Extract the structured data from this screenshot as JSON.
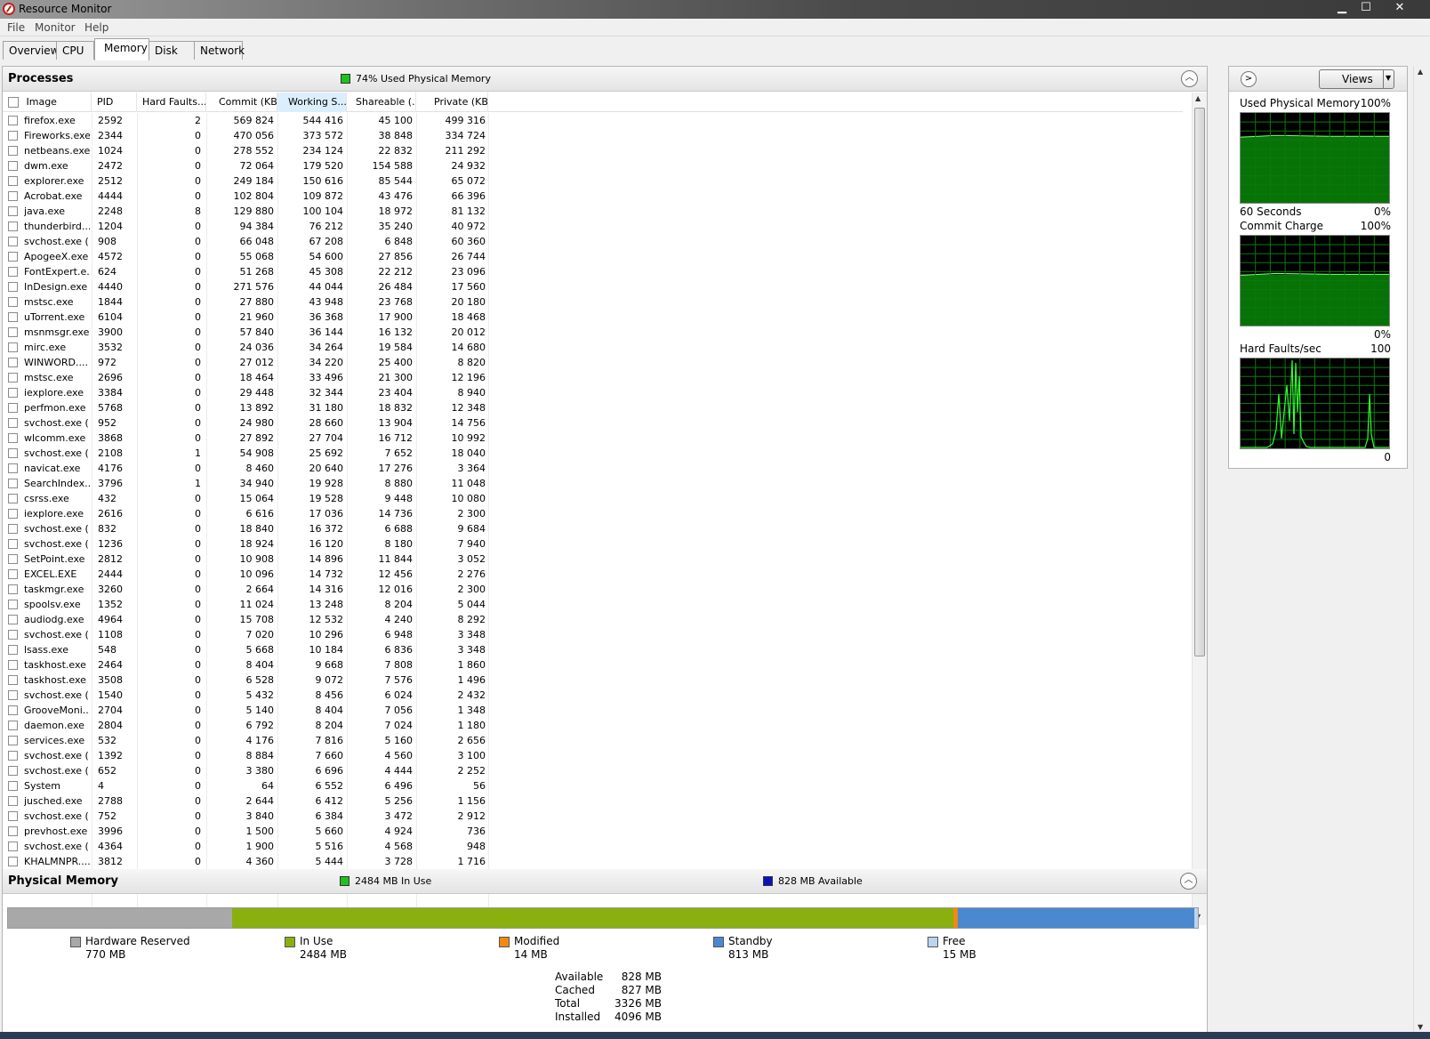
{
  "window": {
    "title": "Resource Monitor",
    "minimize": "▁",
    "maximize": "☐",
    "close": "✕"
  },
  "menu": [
    "File",
    "Monitor",
    "Help"
  ],
  "tabs": [
    "Overview",
    "CPU",
    "Memory",
    "Disk",
    "Network"
  ],
  "active_tab": "Memory",
  "processes": {
    "title": "Processes",
    "summary": "74% Used Physical Memory",
    "summary_color": "#20c020",
    "columns": [
      "Image",
      "PID",
      "Hard Faults...",
      "Commit (KB)",
      "Working S...",
      "Shareable (...",
      "Private (KB)"
    ],
    "sorted_column": "Working S...",
    "rows": [
      [
        "firefox.exe",
        "2592",
        "2",
        "569 824",
        "544 416",
        "45 100",
        "499 316"
      ],
      [
        "Fireworks.exe",
        "2344",
        "0",
        "470 056",
        "373 572",
        "38 848",
        "334 724"
      ],
      [
        "netbeans.exe",
        "1024",
        "0",
        "278 552",
        "234 124",
        "22 832",
        "211 292"
      ],
      [
        "dwm.exe",
        "2472",
        "0",
        "72 064",
        "179 520",
        "154 588",
        "24 932"
      ],
      [
        "explorer.exe",
        "2512",
        "0",
        "249 184",
        "150 616",
        "85 544",
        "65 072"
      ],
      [
        "Acrobat.exe",
        "4444",
        "0",
        "102 804",
        "109 872",
        "43 476",
        "66 396"
      ],
      [
        "java.exe",
        "2248",
        "8",
        "129 880",
        "100 104",
        "18 972",
        "81 132"
      ],
      [
        "thunderbird...",
        "1204",
        "0",
        "94 384",
        "76 212",
        "35 240",
        "40 972"
      ],
      [
        "svchost.exe (...",
        "908",
        "0",
        "66 048",
        "67 208",
        "6 848",
        "60 360"
      ],
      [
        "ApogeeX.exe",
        "4572",
        "0",
        "55 068",
        "54 600",
        "27 856",
        "26 744"
      ],
      [
        "FontExpert.e...",
        "624",
        "0",
        "51 268",
        "45 308",
        "22 212",
        "23 096"
      ],
      [
        "InDesign.exe",
        "4440",
        "0",
        "271 576",
        "44 044",
        "26 484",
        "17 560"
      ],
      [
        "mstsc.exe",
        "1844",
        "0",
        "27 880",
        "43 948",
        "23 768",
        "20 180"
      ],
      [
        "uTorrent.exe",
        "6104",
        "0",
        "21 960",
        "36 368",
        "17 900",
        "18 468"
      ],
      [
        "msnmsgr.exe",
        "3900",
        "0",
        "57 840",
        "36 144",
        "16 132",
        "20 012"
      ],
      [
        "mirc.exe",
        "3532",
        "0",
        "24 036",
        "34 264",
        "19 584",
        "14 680"
      ],
      [
        "WINWORD....",
        "972",
        "0",
        "27 012",
        "34 220",
        "25 400",
        "8 820"
      ],
      [
        "mstsc.exe",
        "2696",
        "0",
        "18 464",
        "33 496",
        "21 300",
        "12 196"
      ],
      [
        "iexplore.exe",
        "3384",
        "0",
        "29 448",
        "32 344",
        "23 404",
        "8 940"
      ],
      [
        "perfmon.exe",
        "5768",
        "0",
        "13 892",
        "31 180",
        "18 832",
        "12 348"
      ],
      [
        "svchost.exe (...",
        "952",
        "0",
        "24 980",
        "28 660",
        "13 904",
        "14 756"
      ],
      [
        "wlcomm.exe",
        "3868",
        "0",
        "27 892",
        "27 704",
        "16 712",
        "10 992"
      ],
      [
        "svchost.exe (...",
        "2108",
        "1",
        "54 908",
        "25 692",
        "7 652",
        "18 040"
      ],
      [
        "navicat.exe",
        "4176",
        "0",
        "8 460",
        "20 640",
        "17 276",
        "3 364"
      ],
      [
        "SearchIndex...",
        "3796",
        "1",
        "34 940",
        "19 928",
        "8 880",
        "11 048"
      ],
      [
        "csrss.exe",
        "432",
        "0",
        "15 064",
        "19 528",
        "9 448",
        "10 080"
      ],
      [
        "iexplore.exe",
        "2616",
        "0",
        "6 616",
        "17 036",
        "14 736",
        "2 300"
      ],
      [
        "svchost.exe (...",
        "832",
        "0",
        "18 840",
        "16 372",
        "6 688",
        "9 684"
      ],
      [
        "svchost.exe (...",
        "1236",
        "0",
        "18 924",
        "16 120",
        "8 180",
        "7 940"
      ],
      [
        "SetPoint.exe",
        "2812",
        "0",
        "10 908",
        "14 896",
        "11 844",
        "3 052"
      ],
      [
        "EXCEL.EXE",
        "2444",
        "0",
        "10 096",
        "14 732",
        "12 456",
        "2 276"
      ],
      [
        "taskmgr.exe",
        "3260",
        "0",
        "2 664",
        "14 316",
        "12 016",
        "2 300"
      ],
      [
        "spoolsv.exe",
        "1352",
        "0",
        "11 024",
        "13 248",
        "8 204",
        "5 044"
      ],
      [
        "audiodg.exe",
        "4964",
        "0",
        "15 708",
        "12 532",
        "4 240",
        "8 292"
      ],
      [
        "svchost.exe (...",
        "1108",
        "0",
        "7 020",
        "10 296",
        "6 948",
        "3 348"
      ],
      [
        "lsass.exe",
        "548",
        "0",
        "5 668",
        "10 184",
        "6 836",
        "3 348"
      ],
      [
        "taskhost.exe",
        "2464",
        "0",
        "8 404",
        "9 668",
        "7 808",
        "1 860"
      ],
      [
        "taskhost.exe",
        "3508",
        "0",
        "6 528",
        "9 072",
        "7 576",
        "1 496"
      ],
      [
        "svchost.exe (...",
        "1540",
        "0",
        "5 432",
        "8 456",
        "6 024",
        "2 432"
      ],
      [
        "GrooveMoni...",
        "2704",
        "0",
        "5 140",
        "8 404",
        "7 056",
        "1 348"
      ],
      [
        "daemon.exe",
        "2804",
        "0",
        "6 792",
        "8 204",
        "7 024",
        "1 180"
      ],
      [
        "services.exe",
        "532",
        "0",
        "4 176",
        "7 816",
        "5 160",
        "2 656"
      ],
      [
        "svchost.exe (...",
        "1392",
        "0",
        "8 884",
        "7 660",
        "4 560",
        "3 100"
      ],
      [
        "svchost.exe (...",
        "652",
        "0",
        "3 380",
        "6 696",
        "4 444",
        "2 252"
      ],
      [
        "System",
        "4",
        "0",
        "64",
        "6 552",
        "6 496",
        "56"
      ],
      [
        "jusched.exe",
        "2788",
        "0",
        "2 644",
        "6 412",
        "5 256",
        "1 156"
      ],
      [
        "svchost.exe (...",
        "752",
        "0",
        "3 840",
        "6 384",
        "3 472",
        "2 912"
      ],
      [
        "prevhost.exe",
        "3996",
        "0",
        "1 500",
        "5 660",
        "4 924",
        "736"
      ],
      [
        "svchost.exe (...",
        "4364",
        "0",
        "1 900",
        "5 516",
        "4 568",
        "948"
      ],
      [
        "KHALMNPR....",
        "3812",
        "0",
        "4 360",
        "5 444",
        "3 728",
        "1 716"
      ]
    ]
  },
  "physical_memory": {
    "title": "Physical Memory",
    "in_use_summary": "2484 MB In Use",
    "available_summary": "828 MB Available",
    "in_use_color": "#20c020",
    "available_color": "#1010c0",
    "legend": [
      {
        "label": "Hardware Reserved",
        "value": "770 MB",
        "color": "#a8a8a8"
      },
      {
        "label": "In Use",
        "value": "2484 MB",
        "color": "#8ab010"
      },
      {
        "label": "Modified",
        "value": "14 MB",
        "color": "#f08a10"
      },
      {
        "label": "Standby",
        "value": "813 MB",
        "color": "#4a88d0"
      },
      {
        "label": "Free",
        "value": "15 MB",
        "color": "#bcd4f0"
      }
    ],
    "bar_mb": [
      770,
      2484,
      14,
      813,
      15
    ],
    "stats": [
      {
        "key": "Available",
        "value": "828 MB"
      },
      {
        "key": "Cached",
        "value": "827 MB"
      },
      {
        "key": "Total",
        "value": "3326 MB"
      },
      {
        "key": "Installed",
        "value": "4096 MB"
      }
    ]
  },
  "graphs": {
    "views_label": "Views",
    "used_physical": {
      "title": "Used Physical Memory",
      "max": "100%",
      "foot_left": "60 Seconds",
      "foot_right": "0%",
      "level_fraction": 0.74
    },
    "commit_charge": {
      "title": "Commit Charge",
      "max": "100%",
      "foot_right": "0%",
      "level_fraction": 0.57
    },
    "hard_faults": {
      "title": "Hard Faults/sec",
      "max": "100",
      "foot_right": "0"
    }
  },
  "icons": {
    "app": "resource-monitor-icon",
    "collapse": "chevron-up-icon",
    "expand": "chevron-right-icon",
    "dropdown": "triangle-down-icon"
  }
}
